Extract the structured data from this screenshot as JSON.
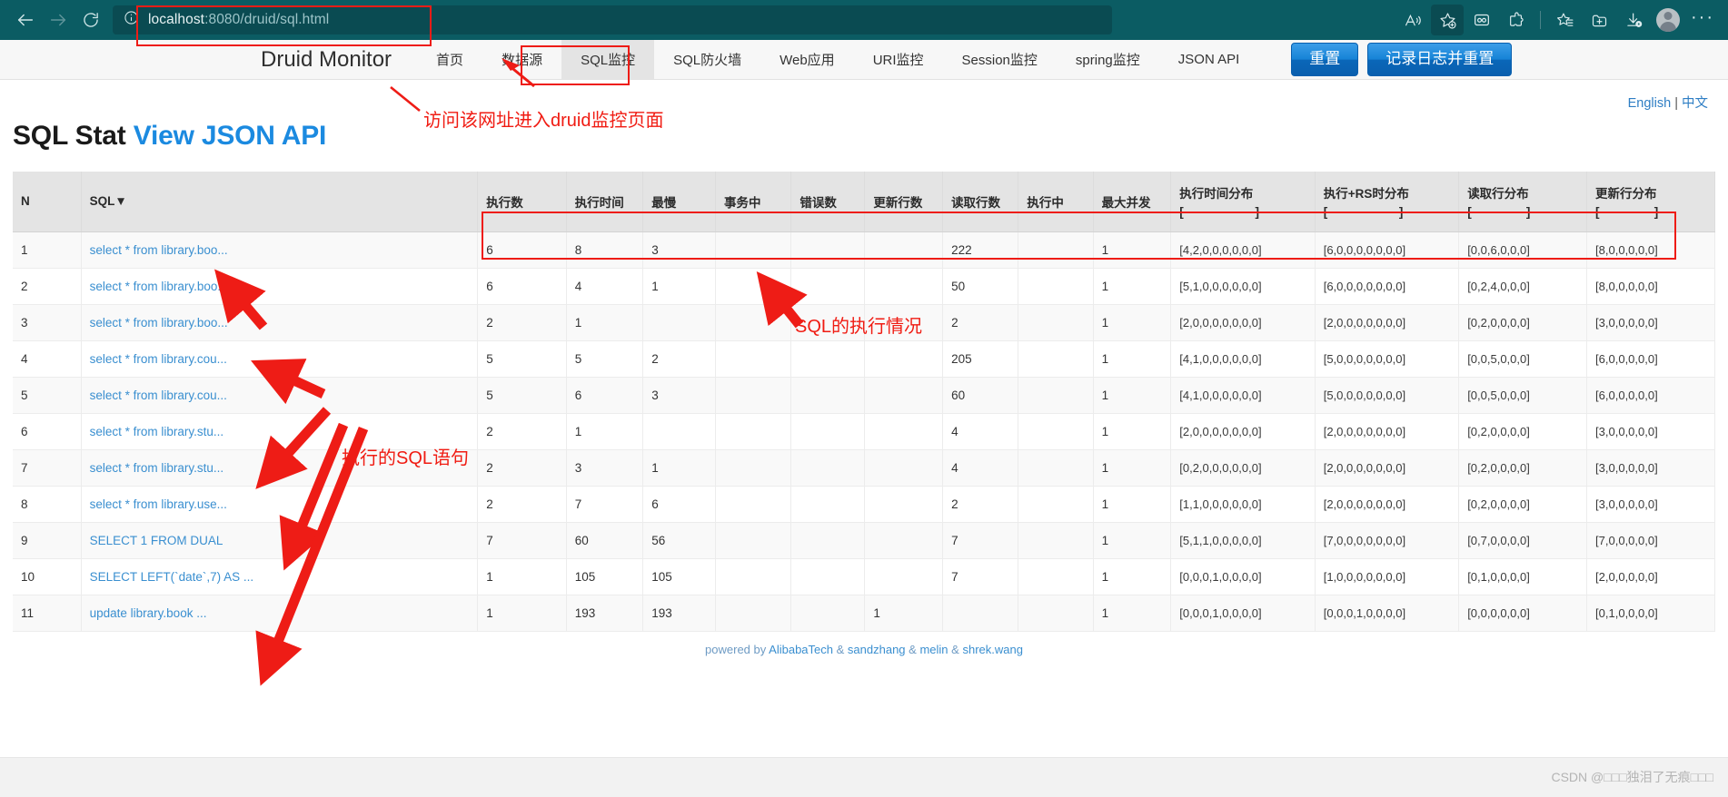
{
  "browser": {
    "back_icon": "back-arrow-icon",
    "forward_icon": "forward-arrow-icon",
    "reload_icon": "reload-icon",
    "info_icon": "info-icon",
    "url_host": "localhost",
    "url_path": ":8080/druid/sql.html",
    "url_full": "localhost:8080/druid/sql.html",
    "toolbar_icons": [
      {
        "name": "read-aloud-icon",
        "glyph": "A"
      },
      {
        "name": "add-favorite-icon",
        "glyph": "star-plus"
      },
      {
        "name": "collections-icon",
        "glyph": "binocular"
      },
      {
        "name": "extensions-icon",
        "glyph": "puzzle"
      },
      {
        "name": "favorites-list-icon",
        "glyph": "star-list"
      },
      {
        "name": "split-screen-icon",
        "glyph": "tab-plus"
      },
      {
        "name": "downloads-icon",
        "glyph": "download"
      },
      {
        "name": "profile-avatar",
        "glyph": "avatar"
      },
      {
        "name": "settings-more-icon",
        "glyph": "ellipsis"
      }
    ]
  },
  "site_nav": {
    "brand": "Druid Monitor",
    "items": [
      {
        "key": "home",
        "label": "首页",
        "active": false
      },
      {
        "key": "datasource",
        "label": "数据源",
        "active": false
      },
      {
        "key": "sql-monitor",
        "label": "SQL监控",
        "active": true
      },
      {
        "key": "sql-firewall",
        "label": "SQL防火墙",
        "active": false
      },
      {
        "key": "web-app",
        "label": "Web应用",
        "active": false
      },
      {
        "key": "uri-monitor",
        "label": "URI监控",
        "active": false
      },
      {
        "key": "session-monitor",
        "label": "Session监控",
        "active": false
      },
      {
        "key": "spring-monitor",
        "label": "spring监控",
        "active": false
      },
      {
        "key": "json-api",
        "label": "JSON API",
        "active": false
      }
    ],
    "reset_button": "重置",
    "log_reset_button": "记录日志并重置"
  },
  "lang": {
    "english": "English",
    "separator": "|",
    "chinese": "中文"
  },
  "page": {
    "title": "SQL Stat",
    "api_link": "View JSON API"
  },
  "table": {
    "headers": {
      "n": "N",
      "sql": "SQL",
      "sql_sort_icon": "▼",
      "exec_count": "执行数",
      "exec_time": "执行时间",
      "slowest": "最慢",
      "in_transaction": "事务中",
      "error_count": "错误数",
      "update_rows": "更新行数",
      "read_rows": "读取行数",
      "running": "执行中",
      "max_concurrent": "最大并发",
      "exec_time_dist": "执行时间分布",
      "exec_time_dist_bracket": "[ - - - - - - - - ]",
      "exec_rs_dist": "执行+RS时分布",
      "exec_rs_dist_bracket": "[ - - - - - - - - ]",
      "read_rows_dist": "读取行分布",
      "read_rows_dist_bracket": "[ - - - - - - ]",
      "update_rows_dist": "更新行分布",
      "update_rows_dist_bracket": "[ - - - - - - ]"
    },
    "rows": [
      {
        "n": "1",
        "sql": "select * from library.boo...",
        "exec_count": "6",
        "exec_time": "8",
        "slowest": "3",
        "in_transaction": "",
        "error_count": "",
        "update_rows": "",
        "read_rows": "222",
        "running": "",
        "max_concurrent": "1",
        "exec_time_dist": "[4,2,0,0,0,0,0,0]",
        "exec_rs_dist": "[6,0,0,0,0,0,0,0]",
        "read_rows_dist": "[0,0,6,0,0,0]",
        "update_rows_dist": "[8,0,0,0,0,0]"
      },
      {
        "n": "2",
        "sql": "select * from library.boo...",
        "exec_count": "6",
        "exec_time": "4",
        "slowest": "1",
        "in_transaction": "",
        "error_count": "",
        "update_rows": "",
        "read_rows": "50",
        "running": "",
        "max_concurrent": "1",
        "exec_time_dist": "[5,1,0,0,0,0,0,0]",
        "exec_rs_dist": "[6,0,0,0,0,0,0,0]",
        "read_rows_dist": "[0,2,4,0,0,0]",
        "update_rows_dist": "[8,0,0,0,0,0]"
      },
      {
        "n": "3",
        "sql": "select * from library.boo...",
        "exec_count": "2",
        "exec_time": "1",
        "slowest": "",
        "in_transaction": "",
        "error_count": "",
        "update_rows": "",
        "read_rows": "2",
        "running": "",
        "max_concurrent": "1",
        "exec_time_dist": "[2,0,0,0,0,0,0,0]",
        "exec_rs_dist": "[2,0,0,0,0,0,0,0]",
        "read_rows_dist": "[0,2,0,0,0,0]",
        "update_rows_dist": "[3,0,0,0,0,0]"
      },
      {
        "n": "4",
        "sql": "select * from library.cou...",
        "exec_count": "5",
        "exec_time": "5",
        "slowest": "2",
        "in_transaction": "",
        "error_count": "",
        "update_rows": "",
        "read_rows": "205",
        "running": "",
        "max_concurrent": "1",
        "exec_time_dist": "[4,1,0,0,0,0,0,0]",
        "exec_rs_dist": "[5,0,0,0,0,0,0,0]",
        "read_rows_dist": "[0,0,5,0,0,0]",
        "update_rows_dist": "[6,0,0,0,0,0]"
      },
      {
        "n": "5",
        "sql": "select * from library.cou...",
        "exec_count": "5",
        "exec_time": "6",
        "slowest": "3",
        "in_transaction": "",
        "error_count": "",
        "update_rows": "",
        "read_rows": "60",
        "running": "",
        "max_concurrent": "1",
        "exec_time_dist": "[4,1,0,0,0,0,0,0]",
        "exec_rs_dist": "[5,0,0,0,0,0,0,0]",
        "read_rows_dist": "[0,0,5,0,0,0]",
        "update_rows_dist": "[6,0,0,0,0,0]"
      },
      {
        "n": "6",
        "sql": "select * from library.stu...",
        "exec_count": "2",
        "exec_time": "1",
        "slowest": "",
        "in_transaction": "",
        "error_count": "",
        "update_rows": "",
        "read_rows": "4",
        "running": "",
        "max_concurrent": "1",
        "exec_time_dist": "[2,0,0,0,0,0,0,0]",
        "exec_rs_dist": "[2,0,0,0,0,0,0,0]",
        "read_rows_dist": "[0,2,0,0,0,0]",
        "update_rows_dist": "[3,0,0,0,0,0]"
      },
      {
        "n": "7",
        "sql": "select * from library.stu...",
        "exec_count": "2",
        "exec_time": "3",
        "slowest": "1",
        "in_transaction": "",
        "error_count": "",
        "update_rows": "",
        "read_rows": "4",
        "running": "",
        "max_concurrent": "1",
        "exec_time_dist": "[0,2,0,0,0,0,0,0]",
        "exec_rs_dist": "[2,0,0,0,0,0,0,0]",
        "read_rows_dist": "[0,2,0,0,0,0]",
        "update_rows_dist": "[3,0,0,0,0,0]"
      },
      {
        "n": "8",
        "sql": "select * from library.use...",
        "exec_count": "2",
        "exec_time": "7",
        "slowest": "6",
        "in_transaction": "",
        "error_count": "",
        "update_rows": "",
        "read_rows": "2",
        "running": "",
        "max_concurrent": "1",
        "exec_time_dist": "[1,1,0,0,0,0,0,0]",
        "exec_rs_dist": "[2,0,0,0,0,0,0,0]",
        "read_rows_dist": "[0,2,0,0,0,0]",
        "update_rows_dist": "[3,0,0,0,0,0]"
      },
      {
        "n": "9",
        "sql": "SELECT 1 FROM DUAL",
        "exec_count": "7",
        "exec_time": "60",
        "slowest": "56",
        "in_transaction": "",
        "error_count": "",
        "update_rows": "",
        "read_rows": "7",
        "running": "",
        "max_concurrent": "1",
        "exec_time_dist": "[5,1,1,0,0,0,0,0]",
        "exec_rs_dist": "[7,0,0,0,0,0,0,0]",
        "read_rows_dist": "[0,7,0,0,0,0]",
        "update_rows_dist": "[7,0,0,0,0,0]"
      },
      {
        "n": "10",
        "sql": "SELECT LEFT(`date`,7) AS ...",
        "exec_count": "1",
        "exec_time": "105",
        "slowest": "105",
        "in_transaction": "",
        "error_count": "",
        "update_rows": "",
        "read_rows": "7",
        "running": "",
        "max_concurrent": "1",
        "exec_time_dist": "[0,0,0,1,0,0,0,0]",
        "exec_rs_dist": "[1,0,0,0,0,0,0,0]",
        "read_rows_dist": "[0,1,0,0,0,0]",
        "update_rows_dist": "[2,0,0,0,0,0]"
      },
      {
        "n": "11",
        "sql": "update library.book ...",
        "exec_count": "1",
        "exec_time": "193",
        "slowest": "193",
        "in_transaction": "",
        "error_count": "",
        "update_rows": "1",
        "read_rows": "",
        "running": "",
        "max_concurrent": "1",
        "exec_time_dist": "[0,0,0,1,0,0,0,0]",
        "exec_rs_dist": "[0,0,0,1,0,0,0,0]",
        "read_rows_dist": "[0,0,0,0,0,0]",
        "update_rows_dist": "[0,1,0,0,0,0]"
      }
    ]
  },
  "footer": {
    "powered_by": "powered by",
    "links": [
      "AlibabaTech",
      "sandzhang",
      "melin",
      "shrek.wang"
    ],
    "separator": "&"
  },
  "watermark": "CSDN @□□□独泪了无痕□□□",
  "annotations": {
    "url_note": "访问该网址进入druid监控页面",
    "sql_stmt_note": "执行的SQL语句",
    "sql_exec_note": "SQL的执行情况",
    "color": "#ee1c16"
  }
}
